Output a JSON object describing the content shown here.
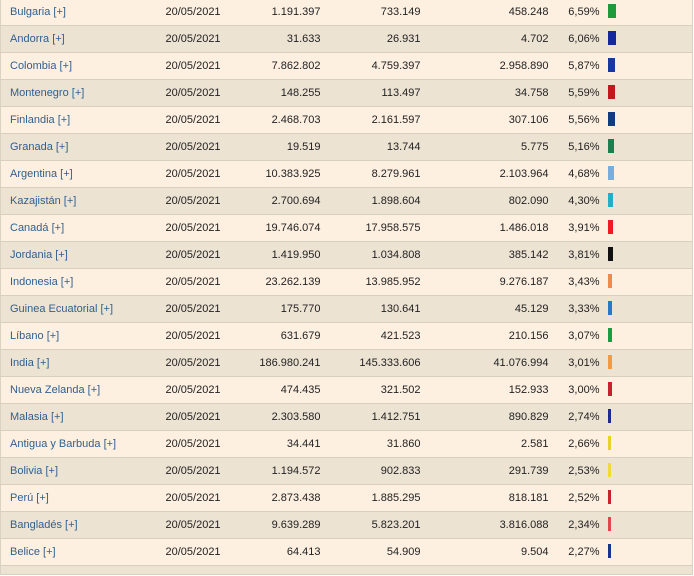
{
  "table": {
    "rows": [
      {
        "country": "Bulgaria [+]",
        "date": "20/05/2021",
        "population": "1.191.397",
        "first_dose": "733.149",
        "full": "458.248",
        "pct": "6,59%",
        "bar_color": "#1f9a3a",
        "bar_width": 8
      },
      {
        "country": "Andorra [+]",
        "date": "20/05/2021",
        "population": "31.633",
        "first_dose": "26.931",
        "full": "4.702",
        "pct": "6,06%",
        "bar_color": "#15279c",
        "bar_width": 8
      },
      {
        "country": "Colombia [+]",
        "date": "20/05/2021",
        "population": "7.862.802",
        "first_dose": "4.759.397",
        "full": "2.958.890",
        "pct": "5,87%",
        "bar_color": "#17389e",
        "bar_width": 7
      },
      {
        "country": "Montenegro [+]",
        "date": "20/05/2021",
        "population": "148.255",
        "first_dose": "113.497",
        "full": "34.758",
        "pct": "5,59%",
        "bar_color": "#c0181b",
        "bar_width": 7
      },
      {
        "country": "Finlandia [+]",
        "date": "20/05/2021",
        "population": "2.468.703",
        "first_dose": "2.161.597",
        "full": "307.106",
        "pct": "5,56%",
        "bar_color": "#143a86",
        "bar_width": 7
      },
      {
        "country": "Granada [+]",
        "date": "20/05/2021",
        "population": "19.519",
        "first_dose": "13.744",
        "full": "5.775",
        "pct": "5,16%",
        "bar_color": "#1b7f4e",
        "bar_width": 6
      },
      {
        "country": "Argentina [+]",
        "date": "20/05/2021",
        "population": "10.383.925",
        "first_dose": "8.279.961",
        "full": "2.103.964",
        "pct": "4,68%",
        "bar_color": "#76aee2",
        "bar_width": 6
      },
      {
        "country": "Kazajistán [+]",
        "date": "20/05/2021",
        "population": "2.700.694",
        "first_dose": "1.898.604",
        "full": "802.090",
        "pct": "4,30%",
        "bar_color": "#1fb0c8",
        "bar_width": 5
      },
      {
        "country": "Canadá [+]",
        "date": "20/05/2021",
        "population": "19.746.074",
        "first_dose": "17.958.575",
        "full": "1.486.018",
        "pct": "3,91%",
        "bar_color": "#ee1b24",
        "bar_width": 5
      },
      {
        "country": "Jordania [+]",
        "date": "20/05/2021",
        "population": "1.419.950",
        "first_dose": "1.034.808",
        "full": "385.142",
        "pct": "3,81%",
        "bar_color": "#111111",
        "bar_width": 5
      },
      {
        "country": "Indonesia [+]",
        "date": "20/05/2021",
        "population": "23.262.139",
        "first_dose": "13.985.952",
        "full": "9.276.187",
        "pct": "3,43%",
        "bar_color": "#f0894a",
        "bar_width": 4
      },
      {
        "country": "Guinea Ecuatorial [+]",
        "date": "20/05/2021",
        "population": "175.770",
        "first_dose": "130.641",
        "full": "45.129",
        "pct": "3,33%",
        "bar_color": "#2878c8",
        "bar_width": 4
      },
      {
        "country": "Líbano [+]",
        "date": "20/05/2021",
        "population": "631.679",
        "first_dose": "421.523",
        "full": "210.156",
        "pct": "3,07%",
        "bar_color": "#1c9b42",
        "bar_width": 4
      },
      {
        "country": "India [+]",
        "date": "20/05/2021",
        "population": "186.980.241",
        "first_dose": "145.333.606",
        "full": "41.076.994",
        "pct": "3,01%",
        "bar_color": "#f59a40",
        "bar_width": 4
      },
      {
        "country": "Nueva Zelanda [+]",
        "date": "20/05/2021",
        "population": "474.435",
        "first_dose": "321.502",
        "full": "152.933",
        "pct": "3,00%",
        "bar_color": "#c8202e",
        "bar_width": 4
      },
      {
        "country": "Malasia [+]",
        "date": "20/05/2021",
        "population": "2.303.580",
        "first_dose": "1.412.751",
        "full": "890.829",
        "pct": "2,74%",
        "bar_color": "#1a2c8e",
        "bar_width": 3
      },
      {
        "country": "Antigua y Barbuda [+]",
        "date": "20/05/2021",
        "population": "34.441",
        "first_dose": "31.860",
        "full": "2.581",
        "pct": "2,66%",
        "bar_color": "#ead12a",
        "bar_width": 3
      },
      {
        "country": "Bolivia [+]",
        "date": "20/05/2021",
        "population": "1.194.572",
        "first_dose": "902.833",
        "full": "291.739",
        "pct": "2,53%",
        "bar_color": "#f2d83a",
        "bar_width": 3
      },
      {
        "country": "Perú [+]",
        "date": "20/05/2021",
        "population": "2.873.438",
        "first_dose": "1.885.295",
        "full": "818.181",
        "pct": "2,52%",
        "bar_color": "#cf1f2a",
        "bar_width": 3
      },
      {
        "country": "Bangladés [+]",
        "date": "20/05/2021",
        "population": "9.639.289",
        "first_dose": "5.823.201",
        "full": "3.816.088",
        "pct": "2,34%",
        "bar_color": "#e2454c",
        "bar_width": 3
      },
      {
        "country": "Belice [+]",
        "date": "20/05/2021",
        "population": "64.413",
        "first_dose": "54.909",
        "full": "9.504",
        "pct": "2,27%",
        "bar_color": "#15358a",
        "bar_width": 3
      }
    ]
  }
}
